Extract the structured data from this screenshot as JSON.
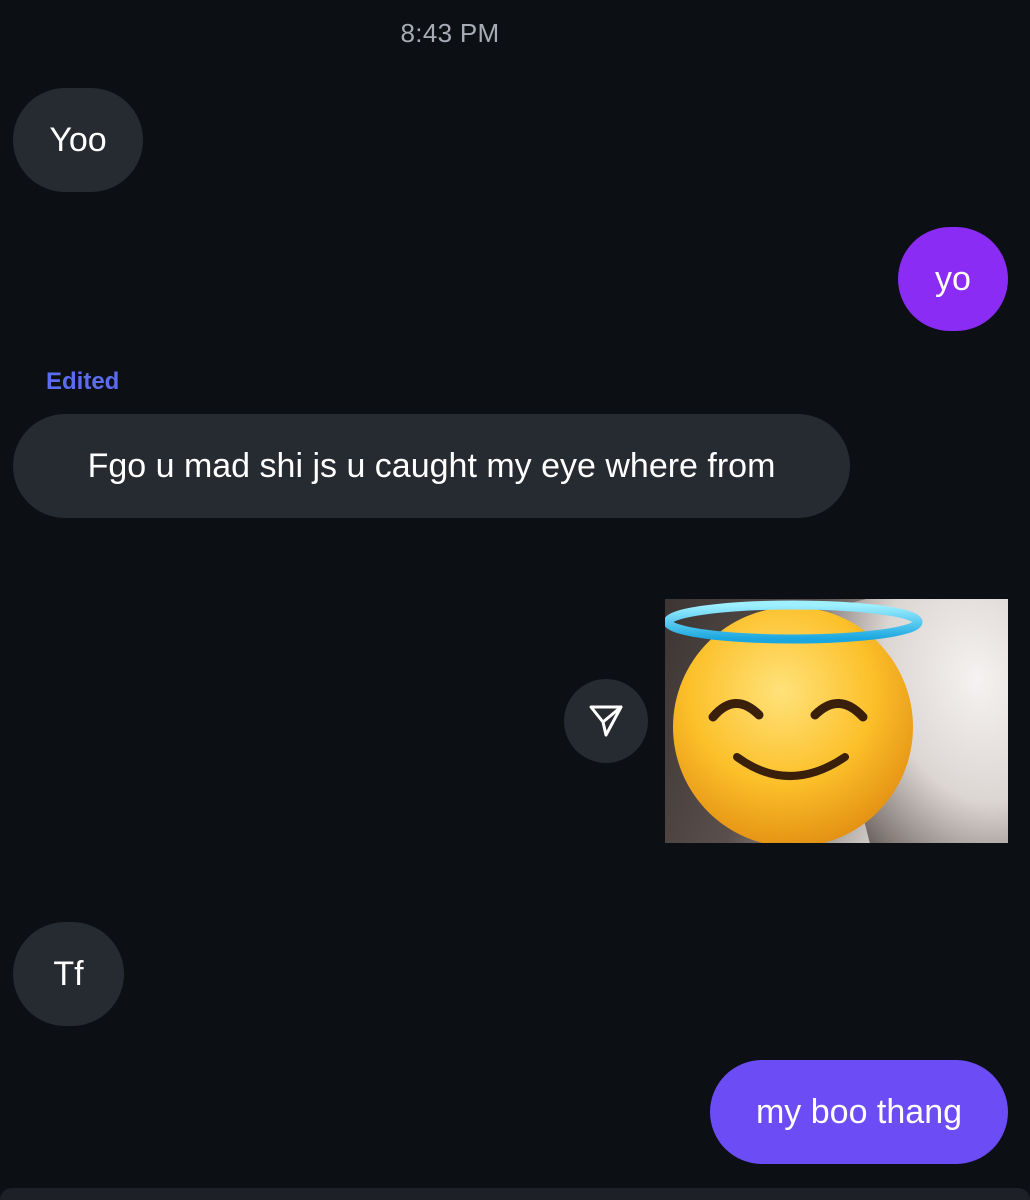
{
  "conversation": {
    "timestamp": "8:43 PM",
    "messages": [
      {
        "sender": "them",
        "text": "Yoo"
      },
      {
        "sender": "me",
        "text": "yo"
      },
      {
        "sender": "them",
        "label": "Edited",
        "text": "Fgo u mad shi js u caught my eye where from"
      },
      {
        "sender": "me",
        "attachment": "photo with smiling-face-with-halo emoji sticker",
        "action_icon": "share-icon"
      },
      {
        "sender": "them",
        "text": "Tf"
      },
      {
        "sender": "me",
        "text": "my boo thang"
      }
    ]
  },
  "colors": {
    "background": "#0c0f14",
    "incoming_bubble": "#262a31",
    "outgoing_bubble": "#8b2cf5",
    "outgoing_bubble_latest": "#6c4cf5",
    "edited_label": "#5b6cf0"
  }
}
